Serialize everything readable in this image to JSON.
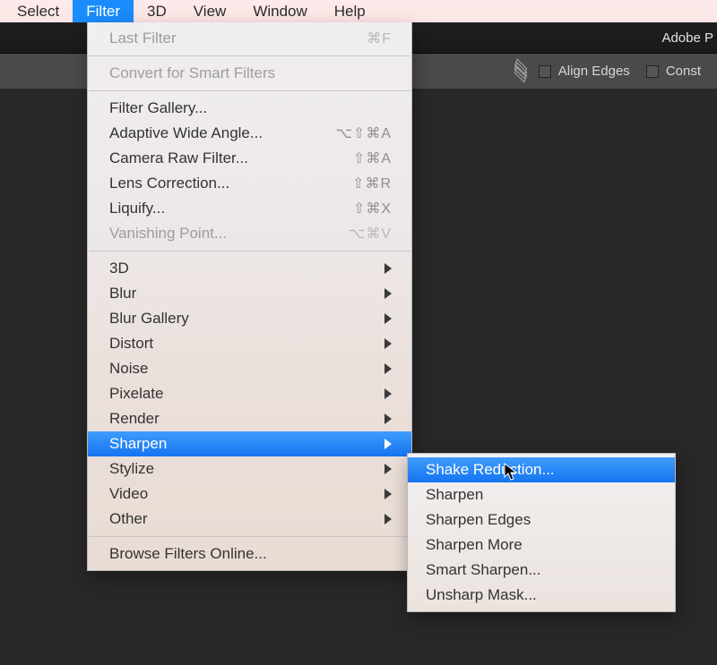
{
  "menubar": {
    "items": [
      "Select",
      "Filter",
      "3D",
      "View",
      "Window",
      "Help"
    ],
    "active_index": 1
  },
  "app_title_fragment": "Adobe P",
  "optionsbar": {
    "align_edges": "Align Edges",
    "constrain_fragment": "Const"
  },
  "filter_menu": {
    "last_filter": {
      "label": "Last Filter",
      "shortcut": "⌘F"
    },
    "convert_smart": "Convert for Smart Filters",
    "gallery": "Filter Gallery...",
    "adaptive": {
      "label": "Adaptive Wide Angle...",
      "shortcut": "⌥⇧⌘A"
    },
    "camera_raw": {
      "label": "Camera Raw Filter...",
      "shortcut": "⇧⌘A"
    },
    "lens": {
      "label": "Lens Correction...",
      "shortcut": "⇧⌘R"
    },
    "liquify": {
      "label": "Liquify...",
      "shortcut": "⇧⌘X"
    },
    "vanishing": {
      "label": "Vanishing Point...",
      "shortcut": "⌥⌘V"
    },
    "sub_3d": "3D",
    "sub_blur": "Blur",
    "sub_blur_gallery": "Blur Gallery",
    "sub_distort": "Distort",
    "sub_noise": "Noise",
    "sub_pixelate": "Pixelate",
    "sub_render": "Render",
    "sub_sharpen": "Sharpen",
    "sub_stylize": "Stylize",
    "sub_video": "Video",
    "sub_other": "Other",
    "browse": "Browse Filters Online..."
  },
  "sharpen_submenu": {
    "shake_reduction": "Shake Reduction...",
    "sharpen": "Sharpen",
    "sharpen_edges": "Sharpen Edges",
    "sharpen_more": "Sharpen More",
    "smart_sharpen": "Smart Sharpen...",
    "unsharp_mask": "Unsharp Mask..."
  }
}
